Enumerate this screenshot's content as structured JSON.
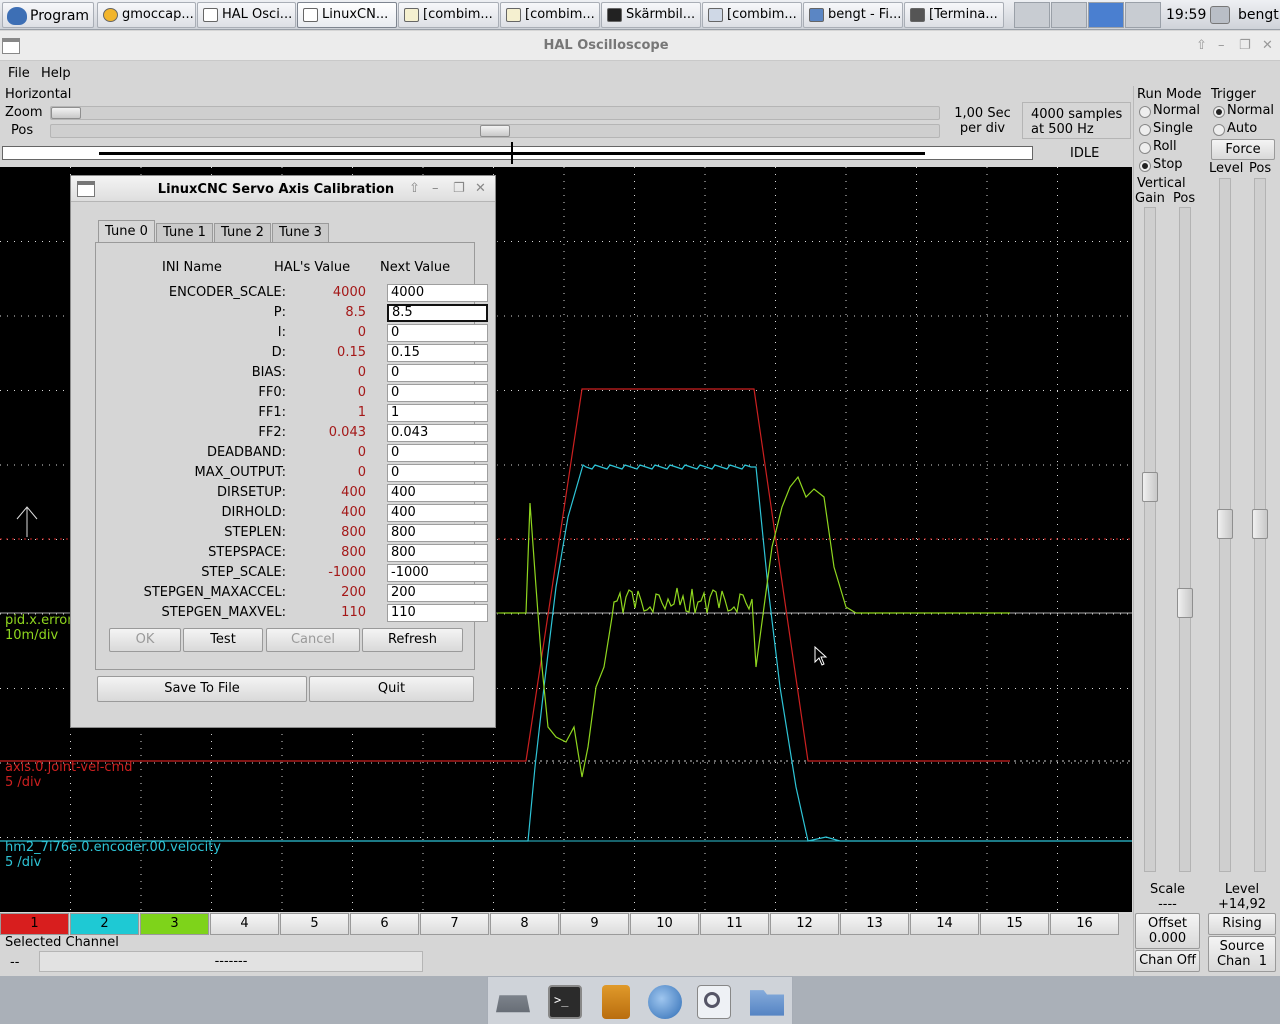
{
  "taskbar": {
    "program_label": "Program",
    "tasks": [
      "gmoccap...",
      "HAL Osci...",
      "LinuxCN...",
      "[combim...",
      "[combim...",
      "Skärmbil...",
      "[combim...",
      "bengt - Fi...",
      "[Termina..."
    ],
    "clock": "19:59",
    "user": "bengt"
  },
  "window": {
    "title": "HAL Oscilloscope",
    "menu": [
      "File",
      "Help"
    ]
  },
  "horizontal": {
    "section_label": "Horizontal",
    "zoom_label": "Zoom",
    "pos_label": "Pos",
    "zoom_level": 0.0,
    "pos_level": 0.5,
    "timebase_line1": "1,00 Sec",
    "timebase_line2": "per div",
    "samples_line1": "4000 samples",
    "samples_line2": "at 500 Hz",
    "state": "IDLE"
  },
  "run_mode": {
    "label": "Run Mode",
    "options": [
      "Normal",
      "Single",
      "Roll",
      "Stop"
    ],
    "selected": "Stop"
  },
  "trigger": {
    "label": "Trigger",
    "options": [
      "Normal",
      "Auto"
    ],
    "selected": "Normal",
    "force_label": "Force",
    "level_label": "Level",
    "pos_label": "Pos",
    "level_readout_label": "Level",
    "level_value": "+14,92",
    "edge_label": "Rising",
    "source_line1": "Source",
    "source_line2": "Chan  1"
  },
  "vertical": {
    "label": "Vertical",
    "gain_label": "Gain",
    "pos_label": "Pos",
    "scale_label": "Scale",
    "scale_value": "----",
    "offset_label": "Offset",
    "offset_value": "0.000",
    "chan_off_label": "Chan Off"
  },
  "scope": {
    "colors": {
      "red": "#cc2020",
      "cyan": "#2ec4d6",
      "green": "#8fd61f",
      "grid": "#d8d8d8"
    },
    "channel_labels": [
      {
        "name": "pid.x.error",
        "scale": "10m/div",
        "color": "#8fd61f"
      },
      {
        "name": "axis.0.joint-vel-cmd",
        "scale": "5 /div",
        "color": "#cc2020"
      },
      {
        "name": "hm2_7i76e.0.encoder.00.velocity",
        "scale": "5 /div",
        "color": "#2ec4d6"
      }
    ]
  },
  "channels": {
    "buttons": [
      "1",
      "2",
      "3",
      "4",
      "5",
      "6",
      "7",
      "8",
      "9",
      "10",
      "11",
      "12",
      "13",
      "14",
      "15",
      "16"
    ],
    "colors": [
      "#d81e1e",
      "#1ec9d4",
      "#7ed31a"
    ],
    "selected_label": "Selected Channel",
    "selected_value": "--",
    "selected_name": "-------"
  },
  "dialog": {
    "title": "LinuxCNC Servo Axis Calibration",
    "tabs": [
      "Tune 0",
      "Tune 1",
      "Tune 2",
      "Tune 3"
    ],
    "headers": {
      "name": "INI Name",
      "hal": "HAL's Value",
      "next": "Next Value"
    },
    "rows": [
      {
        "name": "ENCODER_SCALE:",
        "hal": "4000",
        "next": "4000"
      },
      {
        "name": "P:",
        "hal": "8.5",
        "next": "8.5"
      },
      {
        "name": "I:",
        "hal": "0",
        "next": "0"
      },
      {
        "name": "D:",
        "hal": "0.15",
        "next": "0.15"
      },
      {
        "name": "BIAS:",
        "hal": "0",
        "next": "0"
      },
      {
        "name": "FF0:",
        "hal": "0",
        "next": "0"
      },
      {
        "name": "FF1:",
        "hal": "1",
        "next": "1"
      },
      {
        "name": "FF2:",
        "hal": "0.043",
        "next": "0.043"
      },
      {
        "name": "DEADBAND:",
        "hal": "0",
        "next": "0"
      },
      {
        "name": "MAX_OUTPUT:",
        "hal": "0",
        "next": "0"
      },
      {
        "name": "DIRSETUP:",
        "hal": "400",
        "next": "400"
      },
      {
        "name": "DIRHOLD:",
        "hal": "400",
        "next": "400"
      },
      {
        "name": "STEPLEN:",
        "hal": "800",
        "next": "800"
      },
      {
        "name": "STEPSPACE:",
        "hal": "800",
        "next": "800"
      },
      {
        "name": "STEP_SCALE:",
        "hal": "-1000",
        "next": "-1000"
      },
      {
        "name": "STEPGEN_MAXACCEL:",
        "hal": "200",
        "next": "200"
      },
      {
        "name": "STEPGEN_MAXVEL:",
        "hal": "110",
        "next": "110"
      }
    ],
    "buttons": {
      "ok": "OK",
      "test": "Test",
      "cancel": "Cancel",
      "refresh": "Refresh",
      "save": "Save To File",
      "quit": "Quit"
    }
  },
  "dock": {
    "icons": [
      "drive-icon",
      "terminal-icon",
      "file-cabinet-icon",
      "globe-icon",
      "search-icon",
      "folder-icon"
    ]
  }
}
